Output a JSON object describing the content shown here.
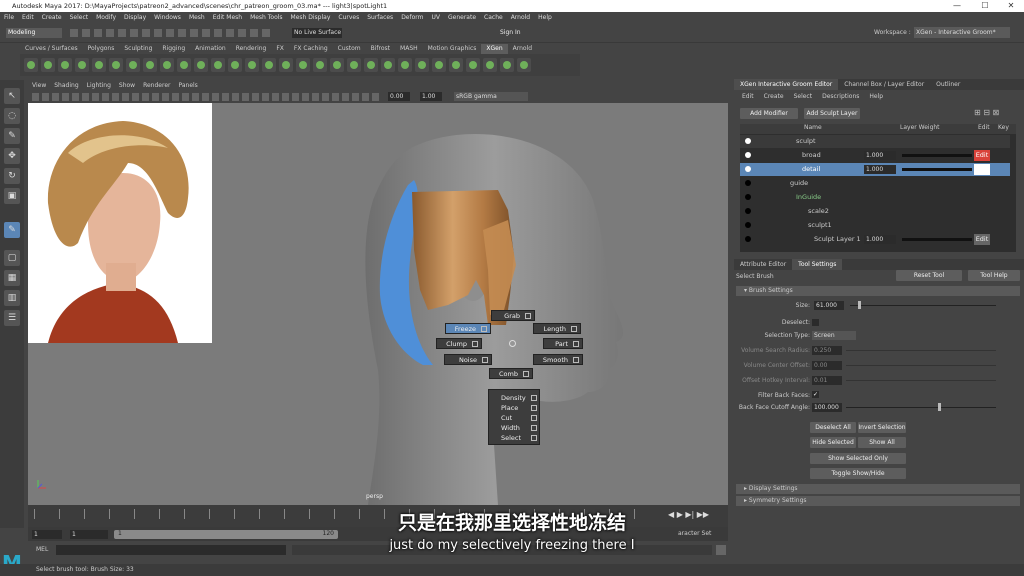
{
  "window": {
    "title": "Autodesk Maya 2017: D:\\MayaProjects\\patreon2_advanced\\scenes\\chr_patreon_groom_03.ma* --- light3|spotLight1",
    "minimize": "—",
    "maximize": "☐",
    "close": "✕"
  },
  "menubar": [
    "File",
    "Edit",
    "Create",
    "Select",
    "Modify",
    "Display",
    "Windows",
    "Mesh",
    "Edit Mesh",
    "Mesh Tools",
    "Mesh Display",
    "Curves",
    "Surfaces",
    "Deform",
    "UV",
    "Generate",
    "Cache",
    "Arnold",
    "Help"
  ],
  "statusline": {
    "mode": "Modeling",
    "live_surface": "No Live Surface",
    "sign_in": "Sign In",
    "workspace_label": "Workspace :",
    "workspace": "XGen - Interactive Groom*"
  },
  "shelf_tabs": [
    "Curves / Surfaces",
    "Polygons",
    "Sculpting",
    "Rigging",
    "Animation",
    "Rendering",
    "FX",
    "FX Caching",
    "Custom",
    "Bifrost",
    "MASH",
    "Motion Graphics",
    "XGen",
    "Arnold"
  ],
  "shelf_active": "XGen",
  "viewport": {
    "menu": [
      "View",
      "Shading",
      "Lighting",
      "Show",
      "Renderer",
      "Panels"
    ],
    "exposure": "0.00",
    "gamma": "1.00",
    "colorspace": "sRGB gamma",
    "camera_label": "persp"
  },
  "marking_menu": {
    "left": [
      "Freeze",
      "Clump",
      "Noise"
    ],
    "top": "Grab",
    "right": [
      "Length",
      "Part",
      "Smooth"
    ],
    "bottom": "Comb",
    "selected": "Freeze",
    "submenu": [
      "Density",
      "Place",
      "Cut",
      "Width",
      "Select"
    ]
  },
  "timeline": {
    "start": "1",
    "start2": "1",
    "range_start": "1",
    "range_end": "120",
    "character_set": "aracter Set"
  },
  "mel_label": "MEL",
  "help_line": "Select brush tool: Brush Size: 33",
  "groom_editor": {
    "tabs": [
      "XGen Interactive Groom Editor",
      "Channel Box / Layer Editor",
      "Outliner"
    ],
    "menu": [
      "Edit",
      "Create",
      "Select",
      "Descriptions",
      "Help"
    ],
    "add_modifier": "Add Modifier",
    "add_sculpt_layer": "Add Sculpt Layer",
    "columns": [
      "Name",
      "Layer Weight",
      "Edit",
      "Key"
    ],
    "rows": [
      {
        "name": "sculpt",
        "weight": "",
        "edit": ""
      },
      {
        "name": "broad",
        "weight": "1.000",
        "edit": "Edit"
      },
      {
        "name": "detail",
        "weight": "1.000",
        "edit": ""
      },
      {
        "name": "guide",
        "weight": "",
        "edit": ""
      },
      {
        "name": "InGuide",
        "weight": "",
        "edit": ""
      },
      {
        "name": "scale2",
        "weight": "",
        "edit": ""
      },
      {
        "name": "sculpt1",
        "weight": "",
        "edit": ""
      },
      {
        "name": "Sculpt Layer 1",
        "weight": "1.000",
        "edit": "Edit"
      }
    ]
  },
  "attribute_editor": {
    "tabs": [
      "Attribute Editor",
      "Tool Settings"
    ],
    "select_brush": "Select Brush",
    "reset_tool": "Reset Tool",
    "tool_help": "Tool Help",
    "brush_settings": "Brush Settings",
    "size_label": "Size:",
    "size_value": "61.000",
    "deselect_label": "Deselect:",
    "selection_type_label": "Selection Type:",
    "selection_type": "Screen",
    "volume_search_radius_label": "Volume Search Radius:",
    "volume_search_radius": "0.250",
    "volume_center_offset_label": "Volume Center Offset:",
    "volume_center_offset": "0.00",
    "offset_hotkey_label": "Offset Hotkey Interval:",
    "offset_hotkey": "0.01",
    "filter_back_faces_label": "Filter Back Faces:",
    "back_face_cutoff_label": "Back Face Cutoff Angle:",
    "back_face_cutoff": "100.000",
    "deselect_all": "Deselect All",
    "invert_selection": "Invert Selection",
    "hide_selected": "Hide Selected",
    "show_all": "Show All",
    "show_selected_only": "Show Selected Only",
    "toggle_show_hide": "Toggle Show/Hide",
    "display_settings": "Display Settings",
    "symmetry_settings": "Symmetry Settings"
  },
  "subtitles": {
    "zh": "只是在我那里选择性地冻结",
    "en": "just do my selectively freezing there I"
  },
  "colors": {
    "accent": "#5b86b6",
    "edit_red": "#d9423a",
    "hair_blue": "#4f8fd8"
  }
}
